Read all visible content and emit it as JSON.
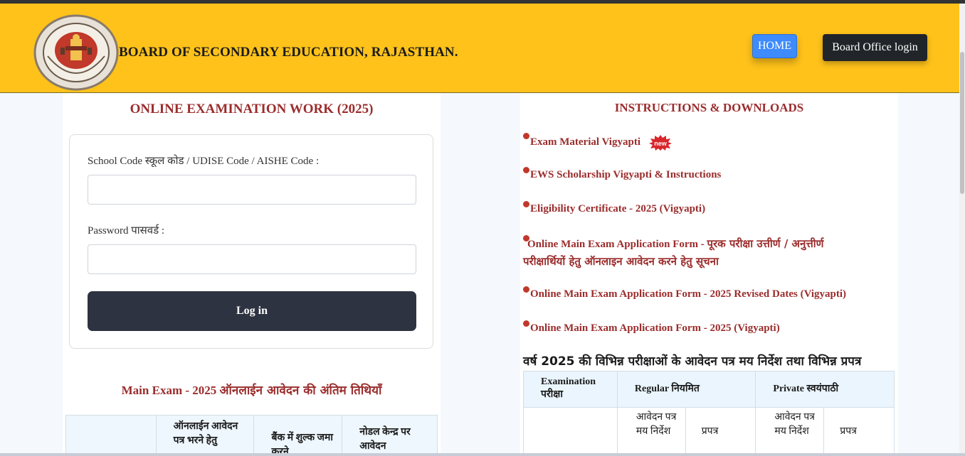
{
  "header": {
    "title": "BOARD OF SECONDARY EDUCATION, RAJASTHAN.",
    "home_label": "HOME",
    "board_login_label": "Board Office login",
    "logo_icon": "board-seal-logo"
  },
  "login": {
    "title": "ONLINE EXAMINATION WORK (2025)",
    "school_code_label": "School Code स्कूल कोड / UDISE Code / AISHE Code :",
    "school_code_value": "",
    "password_label": "Password पासवर्ड :",
    "password_value": "",
    "login_button": "Log in"
  },
  "dates": {
    "title_en": "Main Exam - 2025",
    "title_hi": "ऑनलाईन आवेदन की अंतिम तिथियाँ",
    "headers": [
      "",
      "ऑनलाईन आवेदन पत्र भरने हेतु",
      "बैंक में शुल्क जमा करने",
      "नोडल केन्द्र पर आवेदन"
    ]
  },
  "instructions": {
    "title": "INSTRUCTIONS & DOWNLOADS",
    "new_badge": "new",
    "links": [
      {
        "text": "Exam Material Vigyapti",
        "hindi": "",
        "new": true
      },
      {
        "text": "EWS Scholarship Vigyapti & Instructions",
        "hindi": "",
        "new": false
      },
      {
        "text": "Eligibility Certificate - 2025 (Vigyapti)",
        "hindi": "",
        "new": false
      },
      {
        "text": "Online Main Exam Application Form - ",
        "hindi": "पूरक परीक्षा उत्तीर्ण / अनुत्तीर्ण परीक्षार्थियों हेतु ऑनलाइन आवेदन करने हेतु सूचना",
        "new": false
      },
      {
        "text": "Online Main Exam Application Form - 2025 Revised Dates (Vigyapti)",
        "hindi": "",
        "new": false
      },
      {
        "text": "Online Main Exam Application Form - 2025 (Vigyapti)",
        "hindi": "",
        "new": false
      }
    ]
  },
  "forms": {
    "heading": "वर्ष 2025 की विभिन्न परीक्षाओं के आवेदन पत्र मय निर्देश तथा विभिन्न प्रपत्र",
    "col_exam": "Examination परीक्षा",
    "col_regular": "Regular नियमित",
    "col_private": "Private स्वयंपाठी",
    "sub_instructions": "आवेदन पत्र मय निर्देश",
    "sub_form": "प्रपत्र"
  },
  "colors": {
    "header_bg": "#ffc21a",
    "accent_red": "#9b2c2c",
    "home_blue": "#3d8bfd",
    "dark_button": "#2d3340"
  }
}
